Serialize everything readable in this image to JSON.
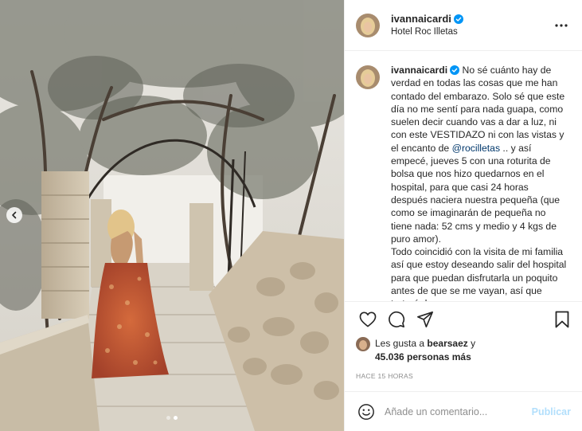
{
  "header": {
    "username": "ivannaicardi",
    "location": "Hotel Roc Illetas",
    "more_icon": "more-horizontal-icon"
  },
  "caption": {
    "username": "ivannaicardi",
    "text_before": "No sé cuánto hay de verdad en todas las cosas que me han contado del embarazo. Solo sé que este día no me sentí para nada guapa, como suelen decir cuando vas a dar a luz, ni con este VESTIDAZO ni con las vistas y el encanto de ",
    "mention": "@rocilletas",
    "text_after": " .. y así empecé, jueves 5 con una roturita de bolsa que nos hizo quedarnos en el hospital, para que casi 24 horas después naciera nuestra pequeña (que como se imaginarán de pequeña no tiene nada: 52 cms y medio y 4 kgs de puro amor).",
    "text_second": "Todo coincidió con la visita de mi familia así que estoy deseando salir del hospital para que puedan disfrutarla un poquito antes de que se me vayan, así que trataré de no"
  },
  "likes": {
    "prefix": "Les gusta a ",
    "user": "bearsaez",
    "middle": " y",
    "count": "45.036 personas más"
  },
  "timestamp": "HACE 15 HORAS",
  "comment_box": {
    "placeholder": "Añade un comentario...",
    "publish_label": "Publicar"
  },
  "carousel": {
    "total": 2,
    "active_index": 1
  },
  "colors": {
    "verified": "#0095f6",
    "mention": "#00376b",
    "publish_disabled": "#b2dffc",
    "muted": "#8e8e8e"
  }
}
